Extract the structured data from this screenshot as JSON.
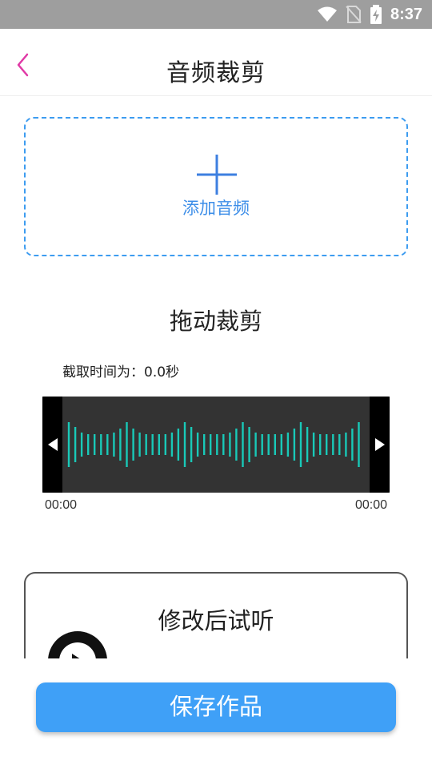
{
  "status_bar": {
    "time": "8:37",
    "icons": [
      "wifi-icon",
      "no-sim-icon",
      "battery-charging-icon"
    ]
  },
  "header": {
    "title": "音频裁剪",
    "back_icon": "chevron-left-icon",
    "accent_color": "#e03aa6"
  },
  "add_audio": {
    "label": "添加音频",
    "icon": "plus-icon",
    "color": "#3d9cf0"
  },
  "trim": {
    "section_title": "拖动裁剪",
    "clip_label": "截取时间为：0.0秒",
    "start_time": "00:00",
    "end_time": "00:00",
    "wave_color": "#19c9b8",
    "left_handle_icon": "triangle-left-icon",
    "right_handle_icon": "triangle-right-icon"
  },
  "preview": {
    "title": "修改后试听",
    "play_icon": "play-icon"
  },
  "save": {
    "label": "保存作品",
    "color": "#3fa0f7"
  }
}
